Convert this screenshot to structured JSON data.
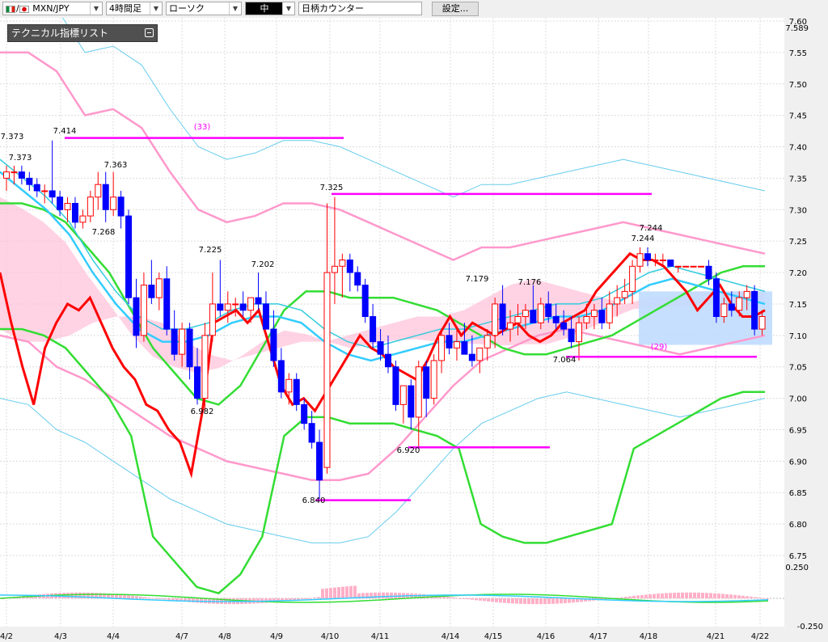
{
  "toolbar": {
    "pair": "MXN/JPY",
    "timeframe": "4時間足",
    "chart_style": "ローソク",
    "size": "中",
    "counter_placeholder": "日柄カウンター",
    "settings_label": "設定..."
  },
  "panel": {
    "title": "テクニカル指標リスト"
  },
  "colors": {
    "background": "#ffffff",
    "up_candle": "#ff0000",
    "down_candle": "#0000ff",
    "ma_short": "#ff0000",
    "ma_mid": "#33ccff",
    "ma_long": "#33dd33",
    "bollinger": "#ff99cc",
    "cloud_bull": "#ffc0d8",
    "cloud_bear": "#c0dcff",
    "annotation": "#ff00ff"
  },
  "chart_data": {
    "type": "candlestick",
    "ylim": [
      6.75,
      7.6
    ],
    "yticks": [
      "7.60",
      "7.55",
      "7.50",
      "7.45",
      "7.40",
      "7.35",
      "7.30",
      "7.25",
      "7.20",
      "7.15",
      "7.10",
      "7.05",
      "7.00",
      "6.95",
      "6.90",
      "6.85",
      "6.80",
      "6.75"
    ],
    "current_price": "7.589",
    "x_dates": [
      "4/2",
      "4/3",
      "4/4",
      "4/7",
      "4/8",
      "4/9",
      "4/10",
      "4/11",
      "4/14",
      "4/15",
      "4/16",
      "4/17",
      "4/18",
      "4/21",
      "4/22"
    ],
    "candles": [
      [
        7.35,
        7.37,
        7.33,
        7.36
      ],
      [
        7.36,
        7.37,
        7.34,
        7.36
      ],
      [
        7.36,
        7.37,
        7.34,
        7.35
      ],
      [
        7.35,
        7.36,
        7.33,
        7.34
      ],
      [
        7.34,
        7.35,
        7.32,
        7.33
      ],
      [
        7.33,
        7.34,
        7.31,
        7.33
      ],
      [
        7.33,
        7.41,
        7.31,
        7.32
      ],
      [
        7.32,
        7.33,
        7.29,
        7.3
      ],
      [
        7.3,
        7.32,
        7.28,
        7.31
      ],
      [
        7.31,
        7.32,
        7.27,
        7.28
      ],
      [
        7.28,
        7.3,
        7.27,
        7.29
      ],
      [
        7.29,
        7.33,
        7.28,
        7.32
      ],
      [
        7.32,
        7.36,
        7.3,
        7.34
      ],
      [
        7.34,
        7.36,
        7.28,
        7.3
      ],
      [
        7.3,
        7.36,
        7.29,
        7.32
      ],
      [
        7.32,
        7.33,
        7.27,
        7.29
      ],
      [
        7.29,
        7.3,
        7.15,
        7.16
      ],
      [
        7.16,
        7.19,
        7.08,
        7.1
      ],
      [
        7.1,
        7.2,
        7.09,
        7.18
      ],
      [
        7.18,
        7.22,
        7.15,
        7.16
      ],
      [
        7.16,
        7.2,
        7.14,
        7.19
      ],
      [
        7.19,
        7.21,
        7.1,
        7.11
      ],
      [
        7.11,
        7.14,
        7.06,
        7.07
      ],
      [
        7.07,
        7.12,
        7.05,
        7.11
      ],
      [
        7.11,
        7.12,
        7.03,
        7.05
      ],
      [
        7.05,
        7.08,
        6.99,
        7.0
      ],
      [
        7.0,
        7.12,
        6.98,
        7.1
      ],
      [
        7.1,
        7.2,
        7.09,
        7.15
      ],
      [
        7.15,
        7.22,
        7.13,
        7.14
      ],
      [
        7.14,
        7.17,
        7.12,
        7.15
      ],
      [
        7.15,
        7.16,
        7.13,
        7.15
      ],
      [
        7.15,
        7.17,
        7.13,
        7.14
      ],
      [
        7.14,
        7.16,
        7.12,
        7.16
      ],
      [
        7.16,
        7.2,
        7.14,
        7.15
      ],
      [
        7.15,
        7.17,
        7.11,
        7.11
      ],
      [
        7.11,
        7.14,
        7.05,
        7.06
      ],
      [
        7.06,
        7.08,
        7.0,
        7.01
      ],
      [
        7.01,
        7.04,
        6.99,
        7.03
      ],
      [
        7.03,
        7.04,
        6.98,
        6.99
      ],
      [
        6.99,
        7.0,
        6.95,
        6.96
      ],
      [
        6.96,
        6.98,
        6.92,
        6.93
      ],
      [
        6.93,
        6.95,
        6.84,
        6.87
      ],
      [
        6.89,
        7.31,
        6.88,
        7.2
      ],
      [
        7.2,
        7.32,
        7.15,
        7.21
      ],
      [
        7.21,
        7.23,
        7.16,
        7.22
      ],
      [
        7.22,
        7.23,
        7.17,
        7.2
      ],
      [
        7.2,
        7.21,
        7.17,
        7.18
      ],
      [
        7.18,
        7.19,
        7.12,
        7.13
      ],
      [
        7.13,
        7.15,
        7.08,
        7.09
      ],
      [
        7.09,
        7.11,
        7.06,
        7.07
      ],
      [
        7.07,
        7.1,
        7.04,
        7.05
      ],
      [
        7.05,
        7.06,
        6.98,
        6.99
      ],
      [
        6.99,
        7.02,
        6.96,
        7.02
      ],
      [
        7.02,
        7.03,
        6.95,
        6.97
      ],
      [
        6.97,
        7.06,
        6.92,
        7.05
      ],
      [
        7.05,
        7.06,
        6.97,
        7.0
      ],
      [
        7.0,
        7.07,
        6.99,
        7.06
      ],
      [
        7.06,
        7.11,
        7.04,
        7.1
      ],
      [
        7.1,
        7.12,
        7.07,
        7.08
      ],
      [
        7.08,
        7.11,
        7.06,
        7.09
      ],
      [
        7.09,
        7.12,
        7.07,
        7.07
      ],
      [
        7.07,
        7.1,
        7.05,
        7.06
      ],
      [
        7.06,
        7.08,
        7.04,
        7.08
      ],
      [
        7.08,
        7.11,
        7.06,
        7.1
      ],
      [
        7.1,
        7.16,
        7.08,
        7.15
      ],
      [
        7.15,
        7.18,
        7.1,
        7.11
      ],
      [
        7.11,
        7.14,
        7.09,
        7.12
      ],
      [
        7.12,
        7.15,
        7.1,
        7.13
      ],
      [
        7.13,
        7.15,
        7.11,
        7.14
      ],
      [
        7.14,
        7.18,
        7.12,
        7.12
      ],
      [
        7.12,
        7.16,
        7.11,
        7.15
      ],
      [
        7.15,
        7.17,
        7.12,
        7.13
      ],
      [
        7.13,
        7.15,
        7.11,
        7.12
      ],
      [
        7.12,
        7.14,
        7.1,
        7.11
      ],
      [
        7.11,
        7.13,
        7.08,
        7.09
      ],
      [
        7.09,
        7.13,
        7.06,
        7.12
      ],
      [
        7.12,
        7.15,
        7.11,
        7.13
      ],
      [
        7.13,
        7.15,
        7.11,
        7.14
      ],
      [
        7.14,
        7.16,
        7.11,
        7.12
      ],
      [
        7.12,
        7.17,
        7.11,
        7.15
      ],
      [
        7.15,
        7.18,
        7.13,
        7.16
      ],
      [
        7.16,
        7.19,
        7.15,
        7.17
      ],
      [
        7.17,
        7.22,
        7.15,
        7.21
      ],
      [
        7.21,
        7.24,
        7.2,
        7.23
      ],
      [
        7.23,
        7.24,
        7.21,
        7.22
      ],
      [
        7.22,
        7.23,
        7.21,
        7.22
      ],
      [
        7.22,
        7.23,
        7.21,
        7.22
      ],
      [
        7.22,
        7.22,
        7.21,
        7.21
      ],
      [
        7.21,
        7.21,
        7.2,
        7.21
      ],
      [
        7.21,
        7.21,
        7.21,
        7.21
      ],
      [
        7.21,
        7.21,
        7.21,
        7.21
      ],
      [
        7.21,
        7.21,
        7.21,
        7.21
      ],
      [
        7.21,
        7.22,
        7.18,
        7.19
      ],
      [
        7.19,
        7.2,
        7.12,
        7.13
      ],
      [
        7.13,
        7.16,
        7.12,
        7.15
      ],
      [
        7.15,
        7.17,
        7.13,
        7.14
      ],
      [
        7.14,
        7.17,
        7.13,
        7.16
      ],
      [
        7.16,
        7.18,
        7.14,
        7.17
      ],
      [
        7.17,
        7.18,
        7.1,
        7.11
      ],
      [
        7.11,
        7.14,
        7.1,
        7.13
      ]
    ],
    "ma_short": [
      7.2,
      7.12,
      7.05,
      6.99,
      7.08,
      7.12,
      7.15,
      7.14,
      7.16,
      7.12,
      7.08,
      7.05,
      7.03,
      6.99,
      6.98,
      6.95,
      6.93,
      6.88,
      6.98,
      7.12,
      7.13,
      7.14,
      7.12,
      7.14,
      7.08,
      7.02,
      6.99,
      7.0,
      6.98,
      7.01,
      7.04,
      7.07,
      7.1,
      7.08,
      7.07,
      7.05,
      7.04,
      7.03,
      7.06,
      7.1,
      7.13,
      7.1,
      7.12,
      7.11,
      7.1,
      7.11,
      7.12,
      7.1,
      7.09,
      7.1,
      7.12,
      7.13,
      7.14,
      7.17,
      7.19,
      7.21,
      7.23,
      7.22,
      7.22,
      7.21,
      7.19,
      7.17,
      7.14,
      7.16,
      7.18,
      7.15,
      7.13,
      7.13,
      7.14
    ],
    "ma_mid": [
      7.36,
      7.33,
      7.3,
      7.26,
      7.2,
      7.15,
      7.11,
      7.09,
      7.09,
      7.1,
      7.12,
      7.13,
      7.13,
      7.12,
      7.09,
      7.07,
      7.06,
      7.07,
      7.08,
      7.09,
      7.09,
      7.1,
      7.11,
      7.12,
      7.13,
      7.13,
      7.14,
      7.16,
      7.18,
      7.19,
      7.18,
      7.17,
      7.16,
      7.15
    ],
    "ma_long": [
      7.31,
      7.31,
      7.3,
      7.28,
      7.24,
      7.2,
      7.14,
      7.08,
      7.04,
      7.0,
      6.99,
      7.02,
      7.08,
      7.14,
      7.17,
      7.17,
      7.16,
      7.16,
      7.16,
      7.15,
      7.14,
      7.12,
      7.1,
      7.08,
      7.07,
      7.07,
      7.08,
      7.09,
      7.1,
      7.12,
      7.14,
      7.16,
      7.18,
      7.2,
      7.21,
      7.21
    ],
    "bb_upper": [
      7.55,
      7.55,
      7.52,
      7.45,
      7.46,
      7.43,
      7.36,
      7.3,
      7.28,
      7.29,
      7.31,
      7.31,
      7.3,
      7.28,
      7.26,
      7.24,
      7.22,
      7.24,
      7.24,
      7.25,
      7.26,
      7.27,
      7.28,
      7.27,
      7.26,
      7.25,
      7.24,
      7.23
    ],
    "bb_lower": [
      7.1,
      7.09,
      7.05,
      7.03,
      7.0,
      6.97,
      6.94,
      6.92,
      6.9,
      6.89,
      6.88,
      6.87,
      6.87,
      6.88,
      6.92,
      6.97,
      7.02,
      7.06,
      7.08,
      7.1,
      7.11,
      7.1,
      7.09,
      7.08,
      7.07,
      7.08,
      7.09,
      7.1
    ],
    "price_labels": [
      "7.373",
      "7.373",
      "7.414",
      "7.363",
      "7.268",
      "7.225",
      "7.202",
      "6.982",
      "7.325",
      "6.840",
      "6.920",
      "7.179",
      "7.176",
      "7.064",
      "7.244",
      "7.244"
    ],
    "annotations": [
      "(33)",
      "(29)"
    ],
    "oscillator": {
      "max_label": "0.250",
      "min_label": "-0.250"
    }
  }
}
